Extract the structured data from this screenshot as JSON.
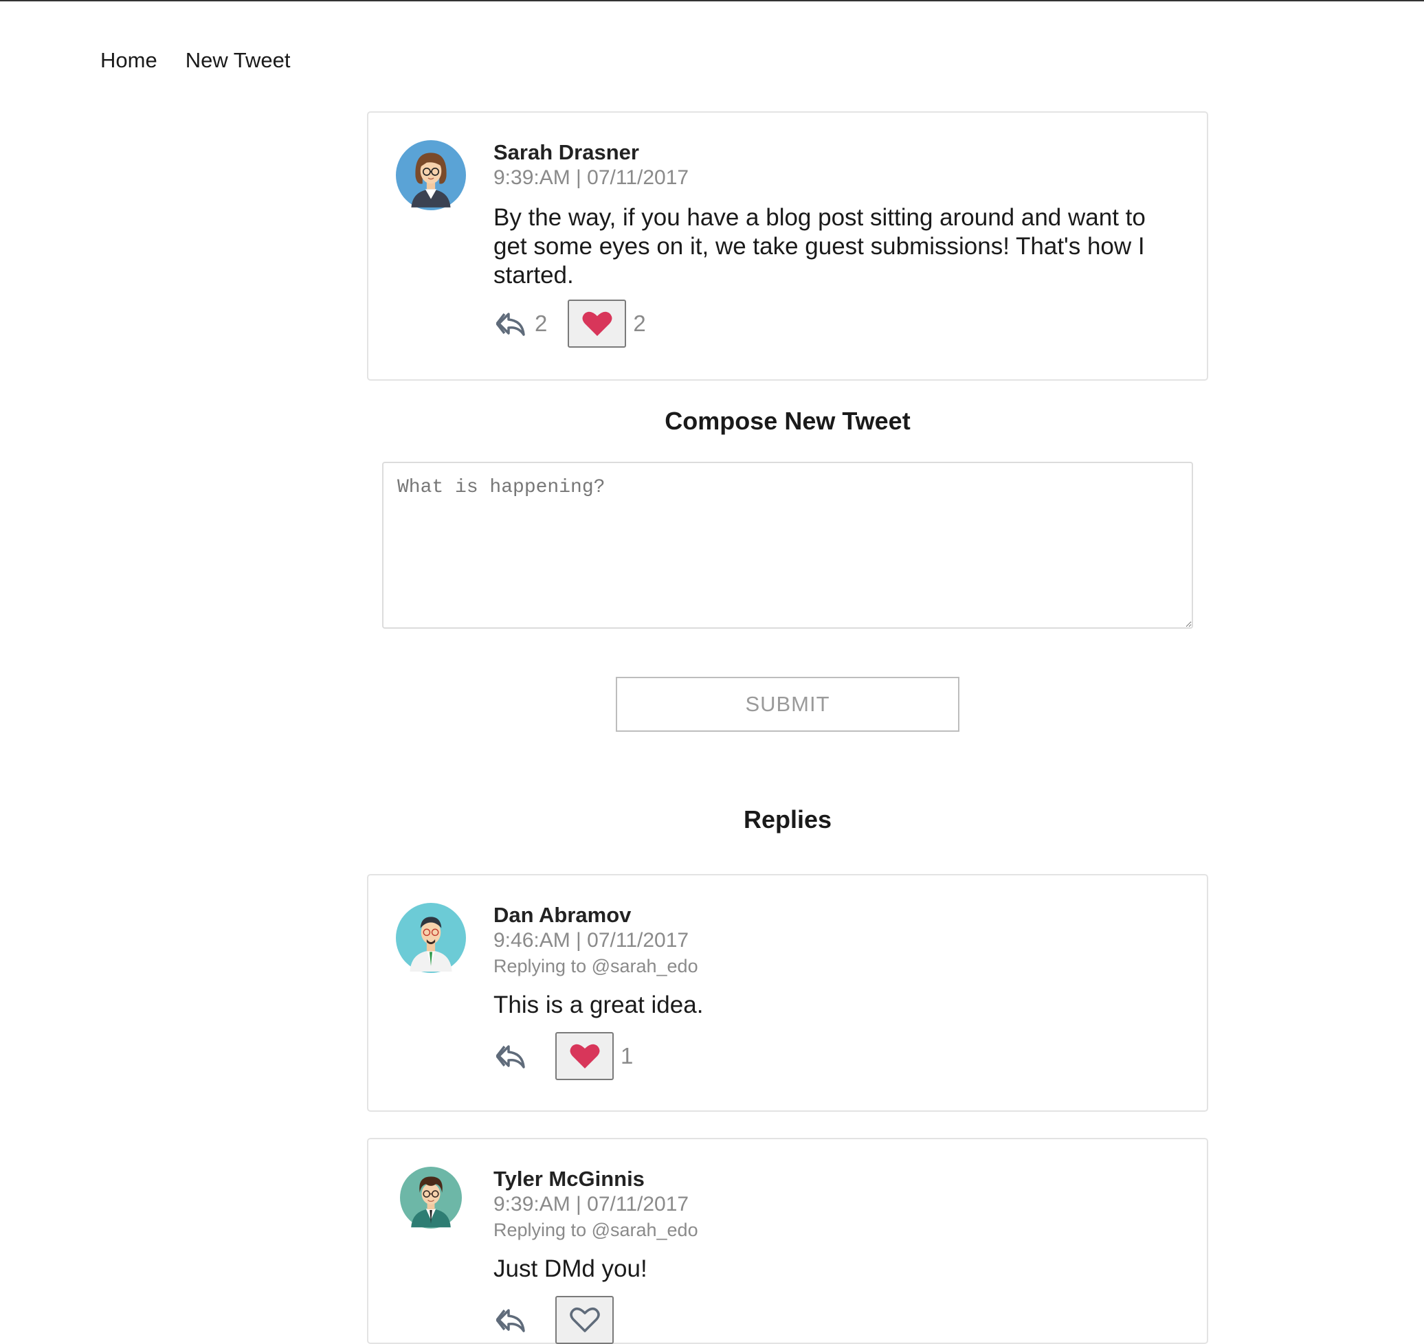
{
  "nav": {
    "home": "Home",
    "new_tweet": "New Tweet"
  },
  "main_tweet": {
    "author": "Sarah Drasner",
    "timestamp": "9:39:AM | 07/11/2017",
    "text": "By the way, if you have a blog post sitting around and want to get some eyes on it, we take guest submissions! That's how I started.",
    "reply_count": "2",
    "like_count": "2",
    "liked": true
  },
  "compose": {
    "title": "Compose New Tweet",
    "placeholder": "What is happening?",
    "submit_label": "SUBMIT"
  },
  "replies_title": "Replies",
  "replies": [
    {
      "author": "Dan Abramov",
      "timestamp": "9:46:AM | 07/11/2017",
      "replying_to": "Replying to @sarah_edo",
      "text": "This is a great idea.",
      "like_count": "1",
      "liked": true
    },
    {
      "author": "Tyler McGinnis",
      "timestamp": "9:39:AM | 07/11/2017",
      "replying_to": "Replying to @sarah_edo",
      "text": "Just DMd you!",
      "liked": false
    }
  ],
  "colors": {
    "heart": "#d8365a",
    "icon_gray": "#5f6b7a"
  }
}
